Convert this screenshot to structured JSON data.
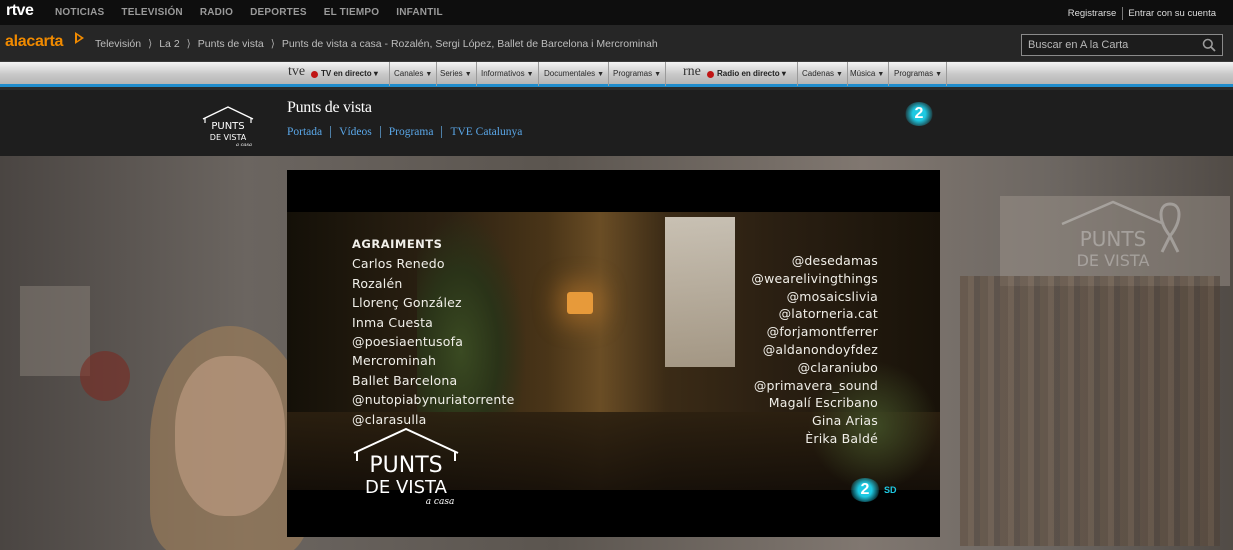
{
  "topbar": {
    "logo": "rtve",
    "nav": [
      "NOTICIAS",
      "TELEVISIÓN",
      "RADIO",
      "DEPORTES",
      "EL TIEMPO",
      "INFANTIL"
    ],
    "register": "Registrarse",
    "login": "Entrar con su cuenta"
  },
  "cartabar": {
    "logo": "alacarta",
    "breadcrumb": [
      "Televisión",
      "La 2",
      "Punts de vista",
      "Punts de vista a casa - Rozalén, Sergi López, Ballet de Barcelona i Mercrominah"
    ],
    "search_placeholder": "Buscar en A la Carta"
  },
  "menubar": {
    "tve_brand": "tve",
    "tv_live": "TV en directo",
    "tv_items": [
      "Canales",
      "Series",
      "Informativos",
      "Documentales",
      "Programas"
    ],
    "rne_brand": "rne",
    "radio_live": "Radio en directo",
    "radio_items": [
      "Cadenas",
      "Música",
      "Programas"
    ]
  },
  "program": {
    "title": "Punts de vista",
    "nav": [
      "Portada",
      "Vídeos",
      "Programa",
      "TVE Catalunya"
    ],
    "channel_badge": "2"
  },
  "logo_text": {
    "line1": "PUNTS",
    "line2": "DE VISTA",
    "line3": "a casa"
  },
  "player": {
    "credits_heading": "AGRAIMENTS",
    "credits_left": [
      "Carlos Renedo",
      "Rozalén",
      "Llorenç González",
      "Inma Cuesta",
      "@poesiaentusofa",
      "Mercrominah",
      "Ballet Barcelona",
      "@nutopiabynuriatorrente",
      "@clarasulla"
    ],
    "credits_right": [
      "@desedamas",
      "@wearelivingthings",
      "@mosaicslivia",
      "@latorneria.cat",
      "@forjamontferrer",
      "@aldanondoyfdez",
      "@claraniubo",
      "@primavera_sound",
      "Magalí Escribano",
      "Gina Arias",
      "Èrika Baldé"
    ],
    "channel_badge": "2",
    "quality": "SD"
  },
  "colors": {
    "accent_blue": "#1f8ccc",
    "alacarta_orange": "#f08a00",
    "la2_cyan": "#1ec9e2",
    "link_blue": "#5aa7e8"
  }
}
